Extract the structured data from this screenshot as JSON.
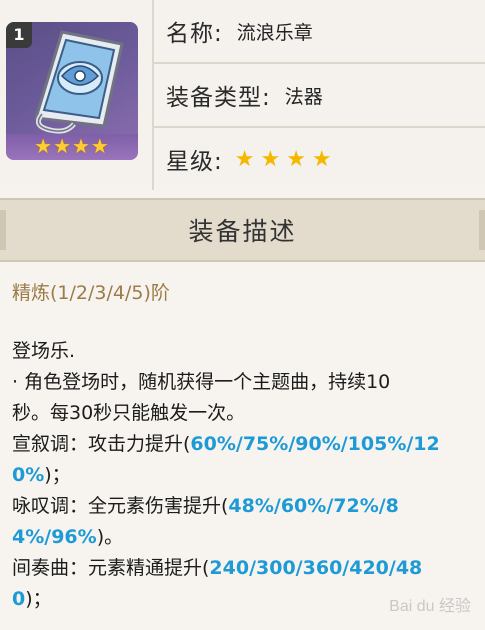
{
  "item": {
    "refine_badge": "1",
    "card_stars": "★★★★",
    "name_label": "名称:",
    "name_value": "流浪乐章",
    "type_label": "装备类型:",
    "type_value": "法器",
    "rarity_label": "星级:",
    "rarity_stars": "★★★★",
    "rarity_count": 4
  },
  "section": {
    "title": "装备描述"
  },
  "description": {
    "refine_line": "精炼(1/2/3/4/5)阶",
    "passive_title": "登场乐.",
    "passive_text": "· 角色登场时，随机获得一个主题曲，持续10\n秒。每30秒只能触发一次。",
    "recitative_prefix": "宣叙调：攻击力提升(",
    "recitative_values": "60%/75%/90%/105%/12\n0%",
    "recitative_suffix": ")；",
    "aria_prefix": "咏叹调：全元素伤害提升(",
    "aria_values": "48%/60%/72%/8\n4%/96%",
    "aria_suffix": ")。",
    "interlude_prefix": "间奏曲：元素精通提升(",
    "interlude_values": "240/300/360/420/48\n0",
    "interlude_suffix": ")；"
  },
  "colors": {
    "highlight": "#1e9ad6",
    "refine_text": "#9c7b48",
    "star": "#f5b800",
    "card": "#6b5a9a"
  },
  "icons": [
    "catalyst-icon",
    "star-icon"
  ],
  "watermark": "Bai du 经验"
}
